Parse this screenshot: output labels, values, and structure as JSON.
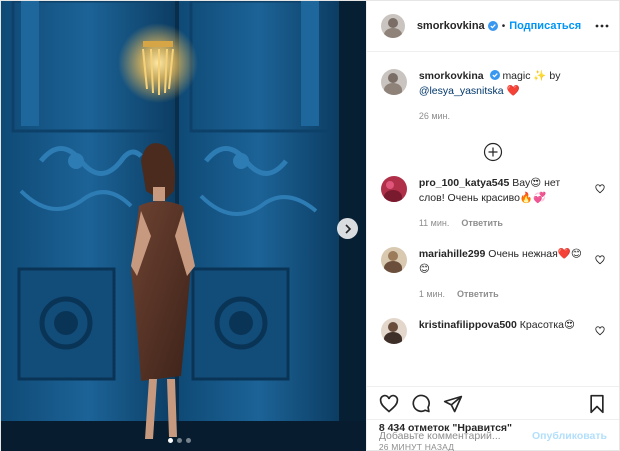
{
  "post": {
    "author": "smorkovkina",
    "separator": "•",
    "follow_label": "Подписаться",
    "caption": {
      "username": "smorkovkina",
      "text": "magic ✨ by",
      "mention": "@lesya_yasnitska",
      "emoji": "❤️",
      "time": "26 мин."
    },
    "comments": [
      {
        "username": "pro_100_katya545",
        "text": "Вау😍 нет слов! Очень красиво🔥💞",
        "time": "11 мин.",
        "reply": "Ответить"
      },
      {
        "username": "mariahille299",
        "text": "Очень нежная❤️😊😊",
        "time": "1 мин.",
        "reply": "Ответить"
      },
      {
        "username": "kristinafilippova500",
        "text": "Красотка😍",
        "time": "",
        "reply": ""
      }
    ],
    "likes": "8 434 отметок \"Нравится\"",
    "timestamp": "26 МИНУТ НАЗАД",
    "comment_placeholder": "Добавьте комментарий...",
    "publish_label": "Опубликовать",
    "carousel": {
      "count": 3,
      "active_index": 0
    },
    "colors": {
      "accent": "#0095f6",
      "publish_disabled": "#b2dffc",
      "door": "#1a5c8f",
      "wall": "#0d3f63"
    }
  }
}
